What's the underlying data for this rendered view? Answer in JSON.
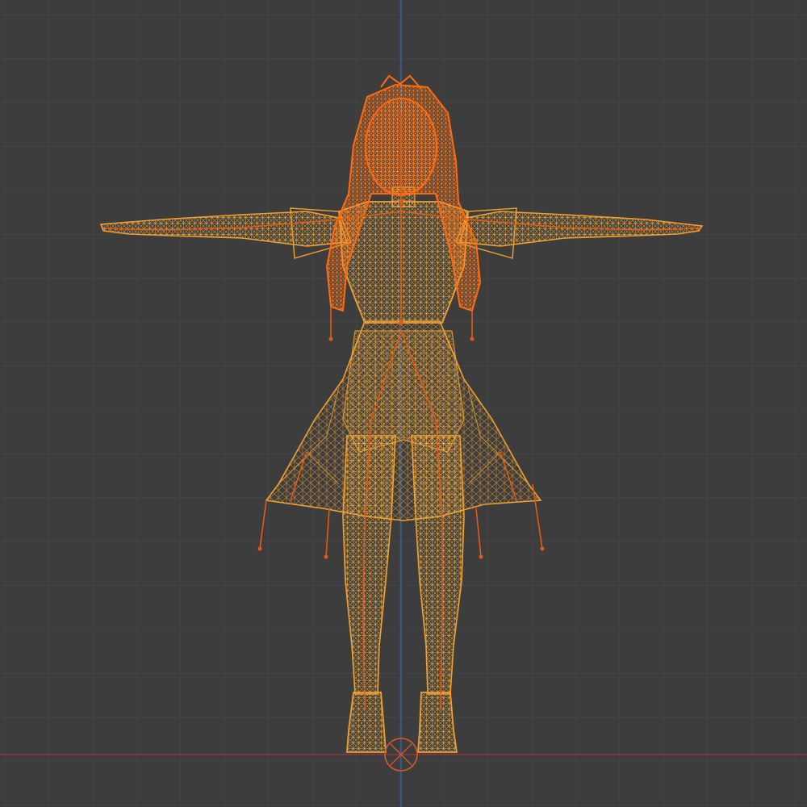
{
  "viewport": {
    "view": "front-orthographic",
    "shading": "wireframe",
    "grid": true,
    "background_color": "#3d3d3d",
    "grid_minor_color": "#474747",
    "grid_major_color": "#545454",
    "axis_x_color": "#9c3a3a",
    "axis_z_color": "#3b65a8"
  },
  "scene": {
    "selected_object": "character-mesh",
    "wire_color_mesh": "#f0a030",
    "wire_color_selected": "#ff6a10",
    "bone_color": "#e05a18",
    "origin_marker": "3d-cursor-icon"
  }
}
